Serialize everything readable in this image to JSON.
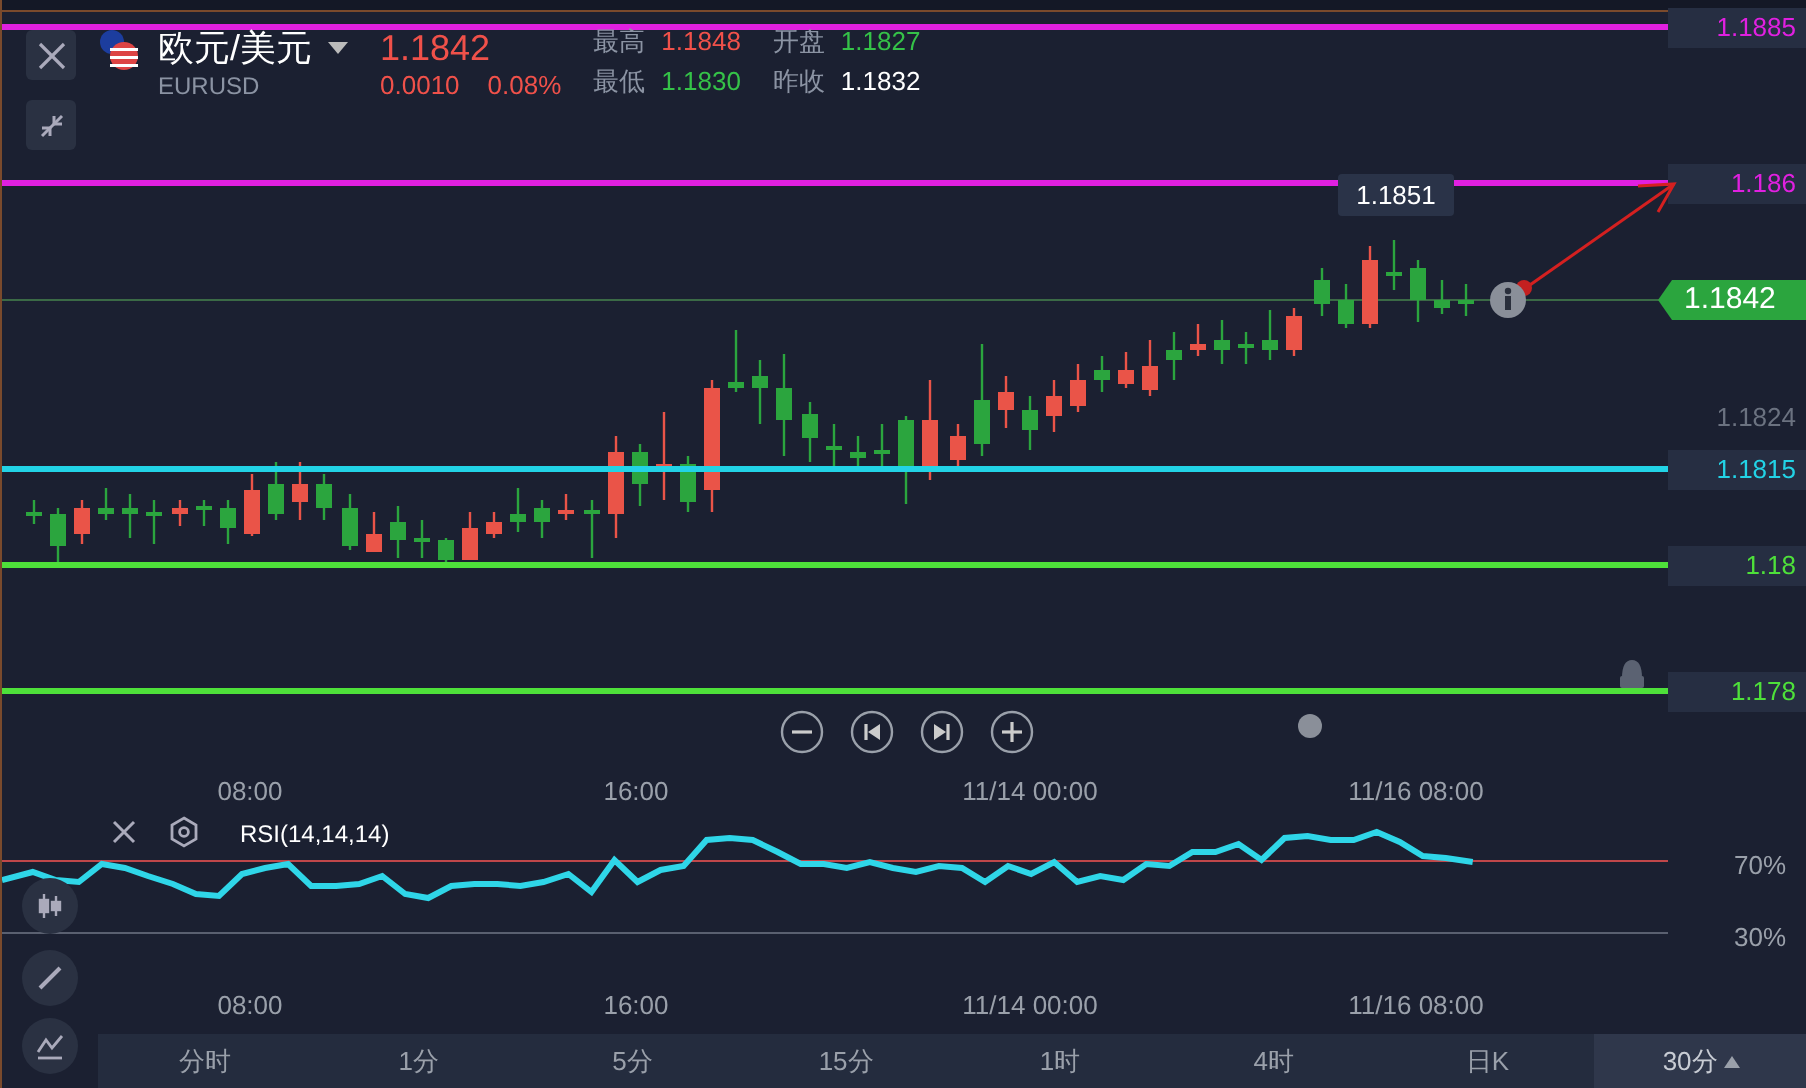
{
  "header": {
    "title": "欧元/美元",
    "symbol": "EURUSD",
    "price": "1.1842",
    "change": "0.0010",
    "change_percent": "0.08%",
    "stats": [
      {
        "label": "最高",
        "value": "1.1848",
        "color": "#f0514a"
      },
      {
        "label": "开盘",
        "value": "1.1827",
        "color": "#35c248"
      },
      {
        "label": "最低",
        "value": "1.1830",
        "color": "#35c248"
      },
      {
        "label": "昨收",
        "value": "1.1832",
        "color": "#ffffff"
      }
    ]
  },
  "price_lines": [
    {
      "label": "1.1885",
      "color": "#e020e0"
    },
    {
      "label": "1.186",
      "color": "#e020e0"
    },
    {
      "label": "1.1815",
      "color": "#22d3e6"
    },
    {
      "label": "1.18",
      "color": "#4ee03a"
    },
    {
      "label": "1.178",
      "color": "#4ee03a"
    }
  ],
  "axis_label": "1.1824",
  "current_price": "1.1842",
  "tooltip": "1.1851",
  "time_axis": [
    "08:00",
    "16:00",
    "11/14 00:00",
    "11/16 08:00"
  ],
  "rsi": {
    "label": "RSI(14,14,14)",
    "levels": [
      "70%",
      "30%"
    ]
  },
  "rsi_time_axis": [
    "08:00",
    "16:00",
    "11/14 00:00",
    "11/16 08:00"
  ],
  "timeframes": [
    {
      "label": "分时",
      "selected": false
    },
    {
      "label": "1分",
      "selected": false
    },
    {
      "label": "5分",
      "selected": false
    },
    {
      "label": "15分",
      "selected": false
    },
    {
      "label": "1时",
      "selected": false
    },
    {
      "label": "4时",
      "selected": false
    },
    {
      "label": "日K",
      "selected": false
    },
    {
      "label": "30分",
      "selected": true
    }
  ]
}
